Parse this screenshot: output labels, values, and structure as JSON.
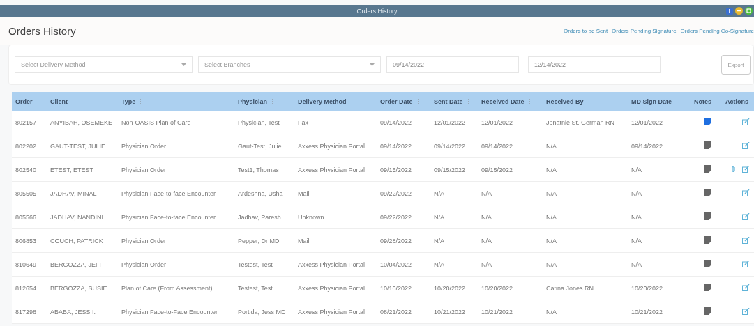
{
  "window": {
    "title": "Orders History"
  },
  "page_title": "Orders History",
  "links": [
    "Orders to be Sent",
    "Orders Pending Signature",
    "Orders Pending Co-Signature"
  ],
  "filters": {
    "delivery_method": {
      "placeholder": "Select Delivery Method"
    },
    "branches": {
      "placeholder": "Select Branches"
    },
    "date_from": {
      "value": "09/14/2022"
    },
    "date_separator": "—",
    "date_to": {
      "value": "12/14/2022"
    },
    "export_button": "Export"
  },
  "table": {
    "columns": [
      {
        "label": "Order",
        "sortable": true
      },
      {
        "label": "Client",
        "sortable": true
      },
      {
        "label": "Type",
        "sortable": true
      },
      {
        "label": "Physician",
        "sortable": true
      },
      {
        "label": "Delivery Method",
        "sortable": true
      },
      {
        "label": "Order Date",
        "sortable": true
      },
      {
        "label": "Sent Date",
        "sortable": true
      },
      {
        "label": "Received Date",
        "sortable": true
      },
      {
        "label": "Received By",
        "sortable": false
      },
      {
        "label": "MD Sign Date",
        "sortable": true
      },
      {
        "label": "Notes",
        "sortable": false
      },
      {
        "label": "Actions",
        "sortable": false
      }
    ],
    "rows": [
      {
        "cells": [
          "802157",
          "ANYIBAH, OSEMEKE",
          "Non-OASIS Plan of Care",
          "Physician, Test",
          "Fax",
          "09/14/2022",
          "12/01/2022",
          "12/01/2022",
          "Jonatnie St. German RN",
          "12/01/2022"
        ],
        "has_notes": true,
        "attachment": false
      },
      {
        "cells": [
          "802202",
          "GAUT-TEST, JULIE",
          "Physician Order",
          "Gaut-Test, Julie",
          "Axxess Physician Portal",
          "09/14/2022",
          "09/14/2022",
          "09/14/2022",
          "N/A",
          "09/14/2022"
        ],
        "has_notes": false,
        "attachment": false
      },
      {
        "cells": [
          "802540",
          "ETEST, ETEST",
          "Physician Order",
          "Test1, Thomas",
          "Axxess Physician Portal",
          "09/15/2022",
          "09/15/2022",
          "09/15/2022",
          "N/A",
          "N/A"
        ],
        "has_notes": false,
        "attachment": true
      },
      {
        "cells": [
          "805505",
          "JADHAV, MINAL",
          "Physician Face-to-face Encounter",
          "Ardeshna, Usha",
          "Mail",
          "09/22/2022",
          "N/A",
          "N/A",
          "N/A",
          "N/A"
        ],
        "has_notes": false,
        "attachment": false
      },
      {
        "cells": [
          "805566",
          "JADHAV, NANDINI",
          "Physician Face-to-face Encounter",
          "Jadhav, Paresh",
          "Unknown",
          "09/22/2022",
          "N/A",
          "N/A",
          "N/A",
          "N/A"
        ],
        "has_notes": false,
        "attachment": false
      },
      {
        "cells": [
          "806853",
          "COUCH, PATRICK",
          "Physician Order",
          "Pepper, Dr MD",
          "Mail",
          "09/28/2022",
          "N/A",
          "N/A",
          "N/A",
          "N/A"
        ],
        "has_notes": false,
        "attachment": false
      },
      {
        "cells": [
          "810649",
          "BERGOZZA, JEFF",
          "Physician Order",
          "Testest, Test",
          "Axxess Physician Portal",
          "10/04/2022",
          "N/A",
          "N/A",
          "N/A",
          "N/A"
        ],
        "has_notes": false,
        "attachment": false
      },
      {
        "cells": [
          "812654",
          "BERGOZZA, SUSIE",
          "Plan of Care (From Assessment)",
          "Testest, Test",
          "Axxess Physician Portal",
          "10/10/2022",
          "10/20/2022",
          "10/20/2022",
          "Catina Jones RN",
          "10/20/2022"
        ],
        "has_notes": false,
        "attachment": false
      },
      {
        "cells": [
          "817298",
          "ABABA, JESS I.",
          "Physician Face-to-Face Encounter",
          "Portida, Jess MD",
          "Axxess Physician Portal",
          "08/21/2022",
          "10/21/2022",
          "10/21/2022",
          "N/A",
          "10/21/2022"
        ],
        "has_notes": false,
        "attachment": false
      }
    ]
  }
}
